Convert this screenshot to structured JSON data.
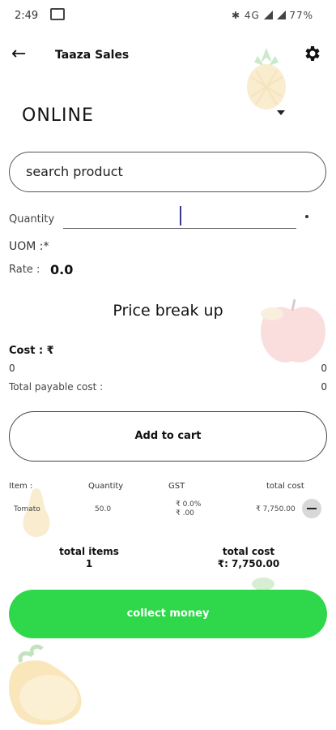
{
  "status_bar": {
    "time": "2:49",
    "battery": "77%",
    "network": "4G"
  },
  "header": {
    "title": "Taaza Sales"
  },
  "mode": {
    "selected": "ONLINE"
  },
  "search": {
    "placeholder": "search product"
  },
  "form": {
    "quantity_label": "Quantity",
    "quantity_value": "",
    "uom_label": "UOM :*",
    "rate_label": "Rate :",
    "rate_value": "0.0"
  },
  "price_breakup": {
    "title": "Price break up",
    "cost_label": "Cost : ₹",
    "cost_left": "0",
    "cost_right": "0",
    "total_payable_label": "Total payable cost :",
    "total_payable_value": "0"
  },
  "add_to_cart": {
    "label": "Add to cart"
  },
  "cart": {
    "columns": [
      "Item :",
      "Quantity",
      "GST",
      "total cost"
    ],
    "rows": [
      {
        "item": "Tomato",
        "quantity": "50.0",
        "gst_percent": "₹ 0.0%",
        "gst_amount": "₹ .00",
        "total_cost": "₹ 7,750.00"
      }
    ]
  },
  "totals": {
    "items_label": "total items",
    "items_value": "1",
    "cost_label": "total cost",
    "cost_value": "₹: 7,750.00"
  },
  "collect_money": {
    "label": "collect money"
  },
  "colors": {
    "accent_green": "#2fd84a"
  },
  "icons": [
    "message-icon",
    "back-arrow-icon",
    "settings-gear-icon",
    "dropdown-caret-icon",
    "remove-item-icon"
  ]
}
